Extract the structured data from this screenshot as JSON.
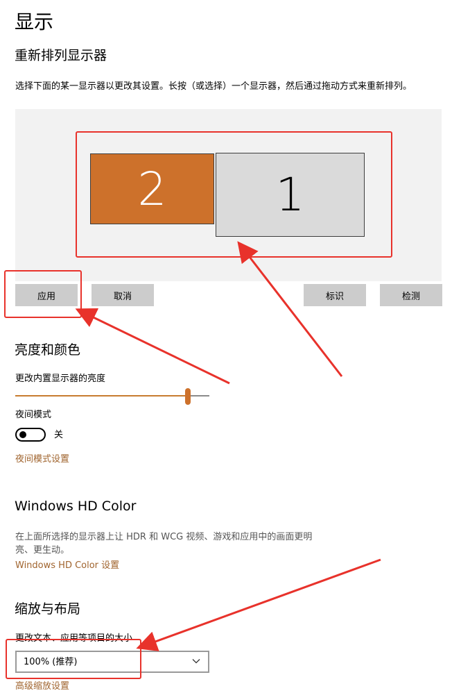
{
  "page": {
    "title": "显示"
  },
  "arrange": {
    "title": "重新排列显示器",
    "description": "选择下面的某一显示器以更改其设置。长按（或选择）一个显示器，然后通过拖动方式来重新排列。",
    "monitors": [
      {
        "label": "2",
        "color": "#cd712b",
        "selected": true
      },
      {
        "label": "1",
        "color": "#dadada",
        "selected": false
      }
    ],
    "buttons": {
      "apply": "应用",
      "cancel": "取消",
      "identify": "标识",
      "detect": "检测"
    }
  },
  "brightness": {
    "title": "亮度和颜色",
    "slider_label": "更改内置显示器的亮度",
    "slider_value_percent": 89,
    "night_mode_label": "夜间模式",
    "night_mode_state": "关",
    "night_mode_settings_link": "夜间模式设置"
  },
  "hdr": {
    "title": "Windows HD Color",
    "description": "在上面所选择的显示器上让 HDR 和 WCG 视频、游戏和应用中的画面更明亮、更生动。",
    "settings_link": "Windows HD Color 设置"
  },
  "scale": {
    "title": "缩放与布局",
    "field_label": "更改文本、应用等项目的大小",
    "selected_option": "100% (推荐)",
    "advanced_link": "高级缩放设置"
  },
  "colors": {
    "accent": "#cd712b",
    "link": "#a0642e",
    "annotation_red": "#e8322b"
  }
}
